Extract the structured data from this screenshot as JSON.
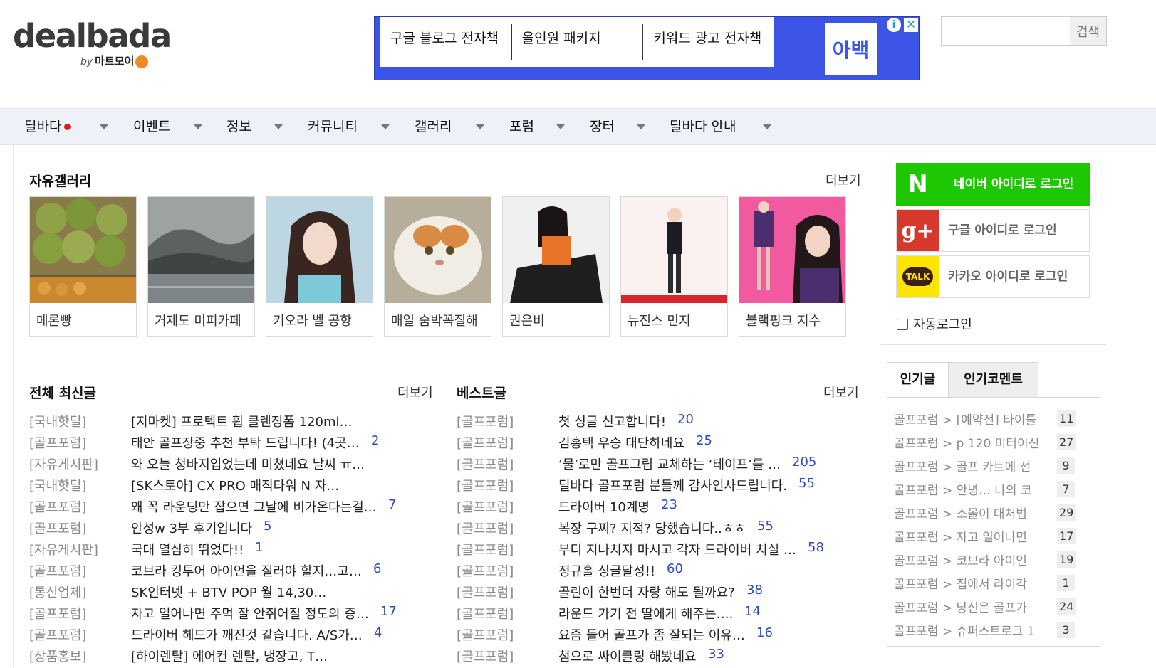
{
  "logo": {
    "main": "dealbada",
    "by": "by",
    "brand": "마트모어"
  },
  "ad": {
    "items": [
      "구글 블로그 전자책",
      "올인원 패키지",
      "키워드 광고 전자책"
    ],
    "logo_text": "아백",
    "info_icon": "info-icon",
    "close_icon": "close-icon",
    "accent": "#3d55e6"
  },
  "search": {
    "placeholder": "",
    "button": "검색"
  },
  "nav": {
    "items": [
      "딜바다",
      "이벤트",
      "정보",
      "커뮤니티",
      "갤러리",
      "포럼",
      "장터",
      "딜바다 안내"
    ]
  },
  "gallery": {
    "title": "자유갤러리",
    "more": "더보기",
    "items": [
      {
        "caption": "메론빵"
      },
      {
        "caption": "거제도 미피카페"
      },
      {
        "caption": "키오라 벨 공항"
      },
      {
        "caption": "매일 숨박꼭질해"
      },
      {
        "caption": "권은비"
      },
      {
        "caption": "뉴진스 민지"
      },
      {
        "caption": "블랙핑크 지수"
      }
    ]
  },
  "latest": {
    "title": "전체 최신글",
    "more": "더보기",
    "posts": [
      {
        "cat": "[국내핫딜]",
        "title": "[지마켓] 프로텍트 휩 클렌징폼 120ml…",
        "count": ""
      },
      {
        "cat": "[골프포럼]",
        "title": "태안 골프장중 추천 부탁 드립니다! (4곳…",
        "count": "2"
      },
      {
        "cat": "[자유게시판]",
        "title": "와 오늘 청바지입었는데 미쳤네요 날씨 ㅠ…",
        "count": ""
      },
      {
        "cat": "[국내핫딜]",
        "title": "[SK스토아] CX PRO 매직타워 N 자…",
        "count": ""
      },
      {
        "cat": "[골프포럼]",
        "title": "왜 꼭 라운딩만 잡으면 그날에 비가온다는걸…",
        "count": "7"
      },
      {
        "cat": "[골프포럼]",
        "title": "안성w 3부 후기입니다",
        "count": "5"
      },
      {
        "cat": "[자유게시판]",
        "title": "국대 열심히 뛰었다!!",
        "count": "1"
      },
      {
        "cat": "[골프포럼]",
        "title": "코브라 킹투어 아이언을 질러야 할지…고…",
        "count": "6"
      },
      {
        "cat": "[통신업체]",
        "title": "SK인터넷 + BTV POP 월 14,30…",
        "count": ""
      },
      {
        "cat": "[골프포럼]",
        "title": "자고 일어나면 주먹 잘 안쥐어질 정도의 증…",
        "count": "17"
      },
      {
        "cat": "[골프포럼]",
        "title": "드라이버 헤드가 깨진것 같습니다. A/S가…",
        "count": "4"
      },
      {
        "cat": "[상품홍보]",
        "title": "[하이렌탈] 에어컨 렌탈, 냉장고, T…",
        "count": ""
      }
    ]
  },
  "best": {
    "title": "베스트글",
    "more": "더보기",
    "posts": [
      {
        "cat": "[골프포럼]",
        "title": "첫 싱글 신고합니다!",
        "count": "20"
      },
      {
        "cat": "[골프포럼]",
        "title": "김홍택 우승 대단하네요",
        "count": "25"
      },
      {
        "cat": "[골프포럼]",
        "title": "‘물’로만 골프그립 교체하는 ‘테이프’를 …",
        "count": "205"
      },
      {
        "cat": "[골프포럼]",
        "title": "딜바다 골프포럼 분들께 감사인사드립니다.",
        "count": "55"
      },
      {
        "cat": "[골프포럼]",
        "title": "드라이버 10계명",
        "count": "23"
      },
      {
        "cat": "[골프포럼]",
        "title": "복장 구찌? 지적? 당했습니다..ㅎㅎ",
        "count": "55"
      },
      {
        "cat": "[골프포럼]",
        "title": "부디 지나치지 마시고 각자 드라이버 치실 …",
        "count": "58"
      },
      {
        "cat": "[골프포럼]",
        "title": "정규홀 싱글달성!!",
        "count": "60"
      },
      {
        "cat": "[골프포럼]",
        "title": "골린이 한번더 자랑 해도 될까요?",
        "count": "38"
      },
      {
        "cat": "[골프포럼]",
        "title": "라운드 가기 전 딸에게 해주는….",
        "count": "14"
      },
      {
        "cat": "[골프포럼]",
        "title": "요즘 들어 골프가 좀 잘되는 이유…",
        "count": "16"
      },
      {
        "cat": "[골프포럼]",
        "title": "첨으로 싸이클링 해봤네요",
        "count": "33"
      }
    ]
  },
  "login": {
    "naver": {
      "label": "네이버 아이디로 로그인",
      "icon": "N"
    },
    "google": {
      "label": "구글 아이디로 로그인",
      "icon": "g+"
    },
    "kakao": {
      "label": "카카오 아이디로 로그인",
      "icon": "TALK"
    },
    "auto": "자동로그인"
  },
  "popular": {
    "tabs": [
      "인기글",
      "인기코멘트"
    ],
    "items": [
      {
        "text": "골프포럼 > [예약전] 타이틀",
        "count": "11"
      },
      {
        "text": "골프포럼 > p 120 미터이신",
        "count": "27"
      },
      {
        "text": "골프포럼 > 골프 카트에 선",
        "count": "9"
      },
      {
        "text": "골프포럼 > 안녕… 나의 코",
        "count": "7"
      },
      {
        "text": "골프포럼 > 소몰이 대처법",
        "count": "29"
      },
      {
        "text": "골프포럼 > 자고 일어나면",
        "count": "17"
      },
      {
        "text": "골프포럼 > 코브라 아이언",
        "count": "19"
      },
      {
        "text": "골프포럼 > 집에서 라이각",
        "count": "1"
      },
      {
        "text": "골프포럼 > 당신은 골프가",
        "count": "24"
      },
      {
        "text": "골프포럼 > 슈퍼스트로크 1",
        "count": "3"
      }
    ]
  }
}
